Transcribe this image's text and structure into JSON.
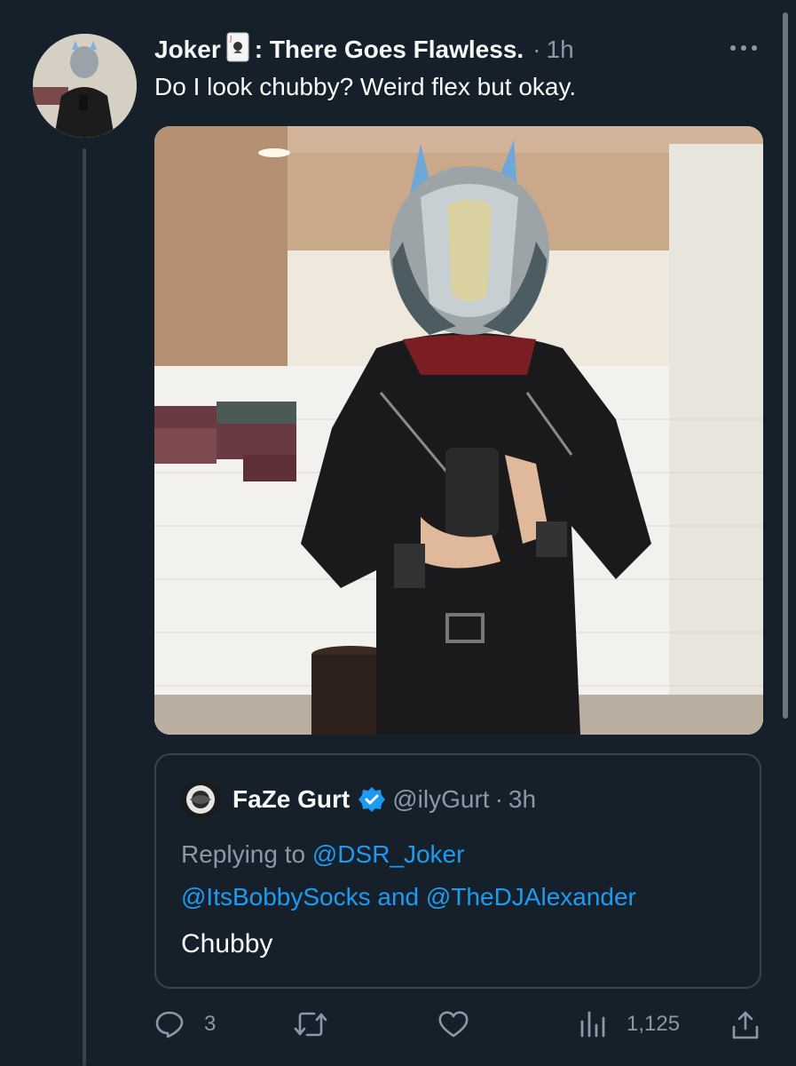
{
  "tweet": {
    "display_name": "Joker",
    "display_name_suffix": ": There Goes Flawless.",
    "time": "1h",
    "text": "Do I look chubby? Weird flex but okay."
  },
  "quote": {
    "name": "FaZe Gurt",
    "handle": "@ilyGurt",
    "time": "3h",
    "replying_prefix": "Replying to",
    "reply_mentions_1": "@DSR_Joker",
    "reply_mention_2": "@ItsBobbySocks",
    "reply_and": "and",
    "reply_mention_3": "@TheDJAlexander",
    "body": "Chubby"
  },
  "actions": {
    "replies": "3",
    "views": "1,125"
  },
  "colors": {
    "background": "#15202b",
    "muted": "#8b98a5",
    "link": "#1d9bf0",
    "border": "#38444d"
  },
  "icons": [
    "more-icon",
    "playing-card-icon",
    "verified-badge-icon",
    "reply-icon",
    "retweet-icon",
    "like-icon",
    "views-icon",
    "share-icon"
  ]
}
